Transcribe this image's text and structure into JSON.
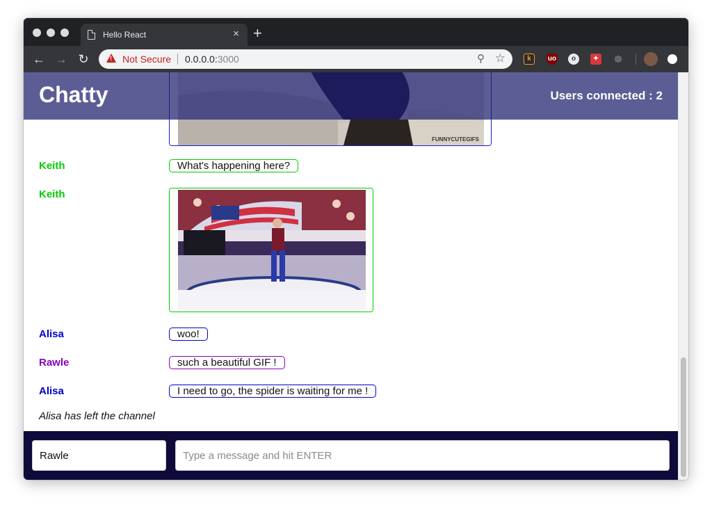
{
  "browser": {
    "tab_title": "Hello React",
    "tab_close": "×",
    "new_tab": "+",
    "security_label": "Not Secure",
    "url_host": "0.0.0.0:",
    "url_port": "3000",
    "icons": [
      "back-icon",
      "forward-icon",
      "reload-icon",
      "warning-icon",
      "zoom-icon",
      "star-icon",
      "keep-extension-icon",
      "ublock-extension-icon",
      "opera-extension-icon",
      "extension-icon",
      "ghost-extension-icon",
      "profile-avatar",
      "menu-dot-icon"
    ]
  },
  "chat": {
    "brand": "Chatty",
    "users_connected": "Users connected : 2",
    "image_watermark": "FUNNYCUTEGIFS",
    "messages": [
      {
        "user": "Keith",
        "text": "What's happening here?",
        "color": "#00cc00"
      },
      {
        "user": "Keith",
        "text": "",
        "color": "#00cc00"
      },
      {
        "user": "Alisa",
        "text": "woo!",
        "color": "#0000cc"
      },
      {
        "user": "Rawle",
        "text": "such a beautiful GIF !",
        "color": "#8800bb"
      },
      {
        "user": "Alisa",
        "text": "I need to go, the spider is waiting for me !",
        "color": "#0000cc"
      }
    ],
    "system_message": "Alisa has left the channel",
    "username_value": "Rawle",
    "message_placeholder": "Type a message and hit ENTER"
  },
  "colors": {
    "navbar": "#3c3d7a",
    "chatbar": "#0e0a3a",
    "keith": "#00cc00",
    "alisa": "#0000cc",
    "rawle": "#8800bb"
  }
}
